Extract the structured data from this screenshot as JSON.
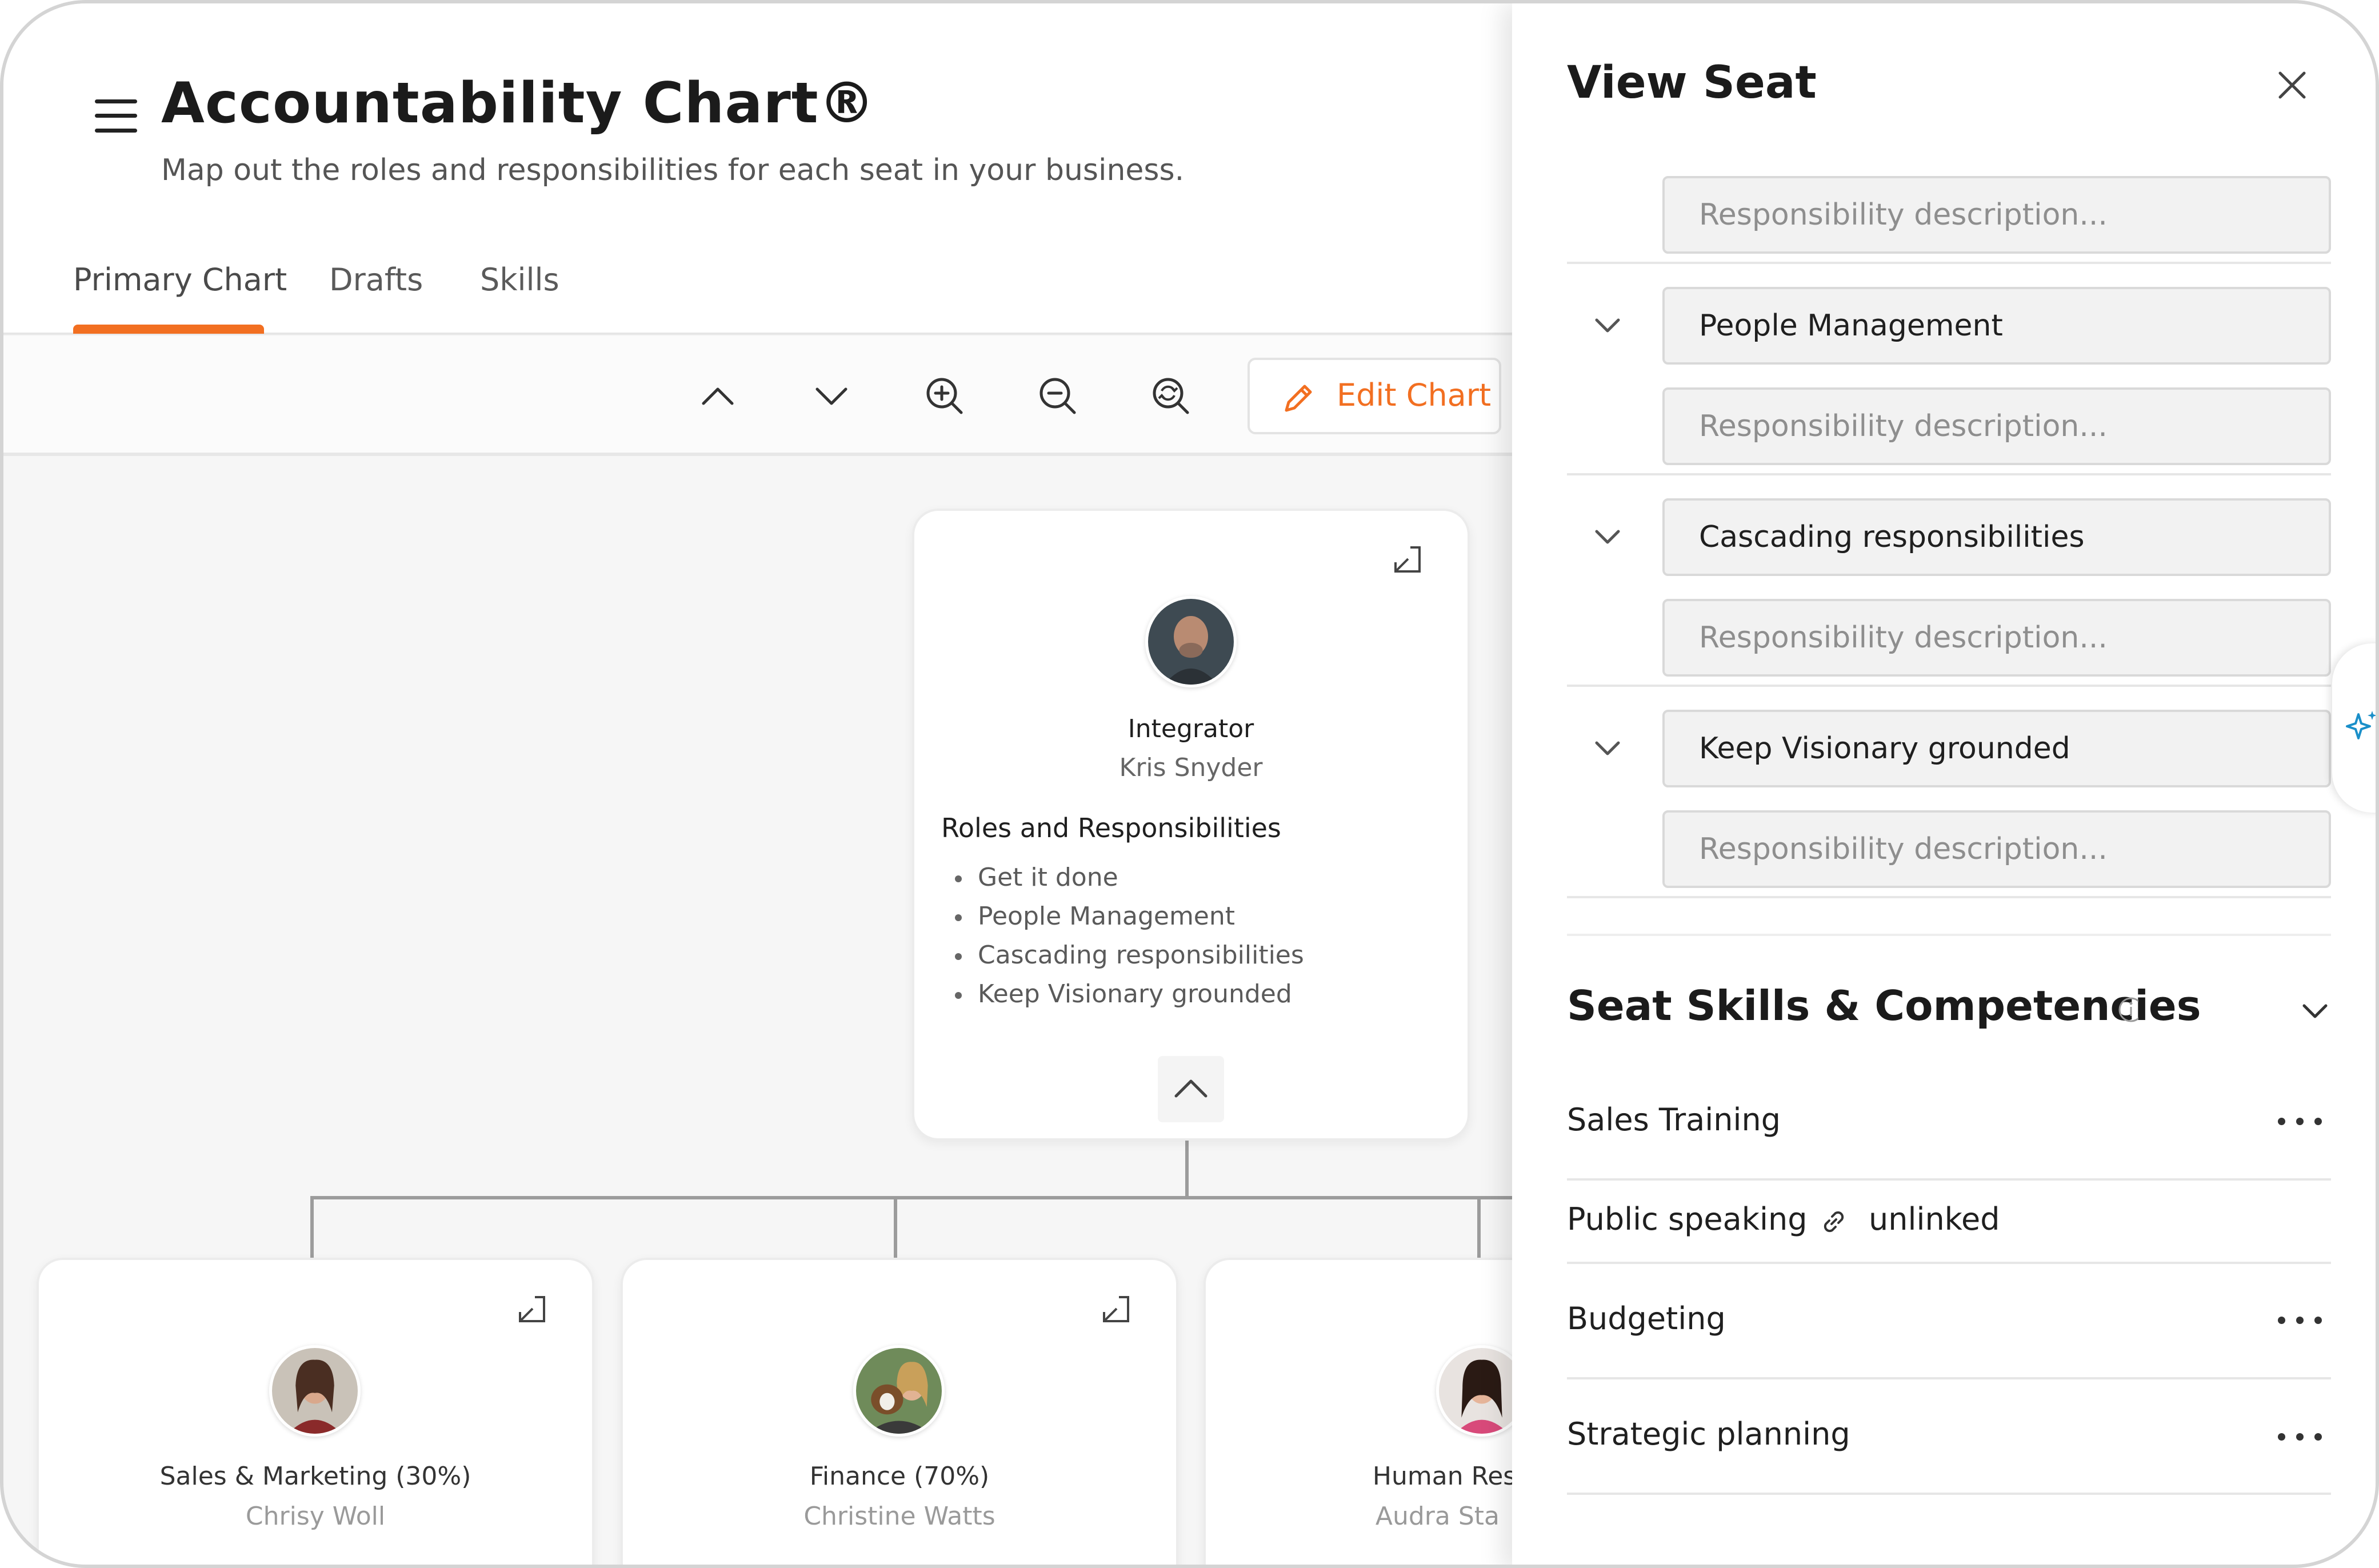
{
  "header": {
    "title": "Accountability Chart®",
    "subtitle": "Map out the roles and responsibilities for each seat in your business."
  },
  "tabs": [
    {
      "label": "Primary Chart",
      "active": true
    },
    {
      "label": "Drafts",
      "active": false
    },
    {
      "label": "Skills",
      "active": false
    }
  ],
  "toolbar": {
    "icons": [
      "chevron-up-icon",
      "chevron-down-icon",
      "zoom-in-icon",
      "zoom-out-icon",
      "zoom-reset-icon"
    ],
    "edit_label": "Edit Chart"
  },
  "seats": {
    "top": {
      "title": "Integrator",
      "person": "Kris Snyder",
      "roles_heading": "Roles and Responsibilities",
      "roles": [
        "Get it done",
        "People Management",
        "Cascading responsibilities",
        "Keep Visionary grounded"
      ]
    },
    "children": [
      {
        "title": "Sales & Marketing (30%)",
        "person": "Chrisy Woll"
      },
      {
        "title": "Finance (70%)",
        "person": "Christine Watts"
      },
      {
        "title": "Human Resou",
        "person": "Audra Sta"
      }
    ]
  },
  "panel": {
    "title": "View Seat",
    "rows": [
      {
        "responsibility": null,
        "description_placeholder": "Responsibility description..."
      },
      {
        "responsibility": "People Management",
        "description_placeholder": "Responsibility description..."
      },
      {
        "responsibility": "Cascading responsibilities",
        "description_placeholder": "Responsibility description..."
      },
      {
        "responsibility": "Keep Visionary grounded",
        "description_placeholder": "Responsibility description..."
      }
    ],
    "skills_title": "Seat Skills & Competencies",
    "skills": [
      {
        "name": "Sales Training",
        "linked": true
      },
      {
        "name": "Public speaking",
        "linked": false,
        "status": "unlinked"
      },
      {
        "name": "Budgeting",
        "linked": true
      },
      {
        "name": "Strategic planning",
        "linked": true
      }
    ]
  },
  "colors": {
    "accent": "#f26f21",
    "ai_icon": "#1a8fc9"
  }
}
